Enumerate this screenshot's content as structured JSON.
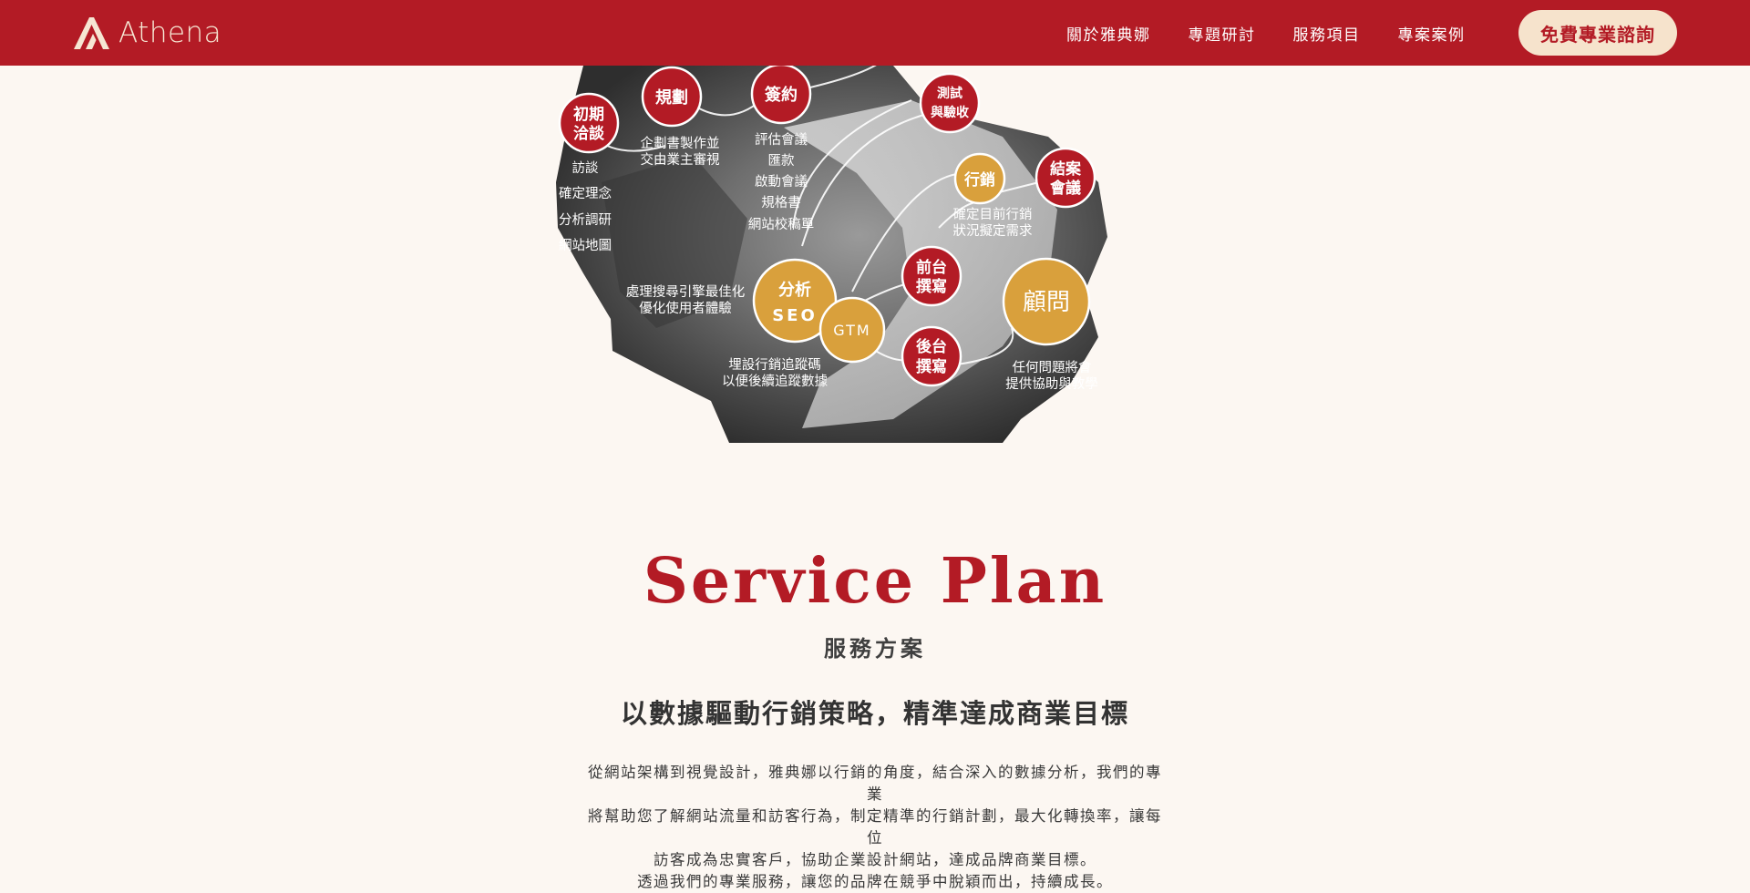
{
  "brand": {
    "name": "Athena",
    "icon": "athena-a-logo-icon"
  },
  "nav": {
    "items": [
      {
        "label": "關於雅典娜"
      },
      {
        "label": "專題研討"
      },
      {
        "label": "服務項目"
      },
      {
        "label": "專案案例"
      }
    ],
    "cta_label": "免費專業諮詢"
  },
  "colors": {
    "brand_red": "#b31b25",
    "gold": "#d9a03c",
    "cream": "#fcf7f2",
    "cta_bg": "#f6e3cc"
  },
  "process": {
    "nodes": [
      {
        "id": "initial",
        "lines": [
          "初期",
          "洽談"
        ],
        "color": "red"
      },
      {
        "id": "plan",
        "lines": [
          "規劃"
        ],
        "color": "red"
      },
      {
        "id": "contract",
        "lines": [
          "簽約"
        ],
        "color": "red"
      },
      {
        "id": "testing",
        "lines": [
          "測試",
          "與驗收"
        ],
        "color": "red"
      },
      {
        "id": "marketing",
        "lines": [
          "行銷"
        ],
        "color": "gold"
      },
      {
        "id": "closing",
        "lines": [
          "結案",
          "會議"
        ],
        "color": "red"
      },
      {
        "id": "frontend",
        "lines": [
          "前台",
          "撰寫"
        ],
        "color": "red"
      },
      {
        "id": "analytics-seo",
        "lines": [
          "分析",
          "SEO"
        ],
        "color": "gold"
      },
      {
        "id": "gtm",
        "lines": [
          "GTM"
        ],
        "color": "gold"
      },
      {
        "id": "backend",
        "lines": [
          "後台",
          "撰寫"
        ],
        "color": "red"
      },
      {
        "id": "consult",
        "lines": [
          "顧問"
        ],
        "color": "gold"
      }
    ],
    "notes": {
      "initial": [
        "訪談",
        "確定理念",
        "分析調研",
        "網站地圖"
      ],
      "plan": [
        "企劃書製作並",
        "交由業主審視"
      ],
      "contract": [
        "評估會議",
        "匯款",
        "啟動會議",
        "規格書",
        "網站校稿單"
      ],
      "seo": [
        "處理搜尋引擎最佳化",
        "優化使用者體驗"
      ],
      "gtm": [
        "埋設行銷追蹤碼",
        "以便後續追蹤數據"
      ],
      "marketing": [
        "確定目前行銷",
        "狀況擬定需求"
      ],
      "consult": [
        "任何問題將會",
        "提供協助與教學"
      ]
    }
  },
  "service_plan": {
    "title": "Service Plan",
    "subtitle": "服務方案",
    "headline": "以數據驅動行銷策略，精準達成商業目標",
    "body": [
      "從網站架構到視覺設計，雅典娜以行銷的角度，結合深入的數據分析，我們的專業",
      "將幫助您了解網站流量和訪客行為，制定精準的行銷計劃，最大化轉換率，讓每位",
      "訪客成為忠實客戶，協助企業設計網站，達成品牌商業目標。",
      "透過我們的專業服務，讓您的品牌在競爭中脫穎而出，持續成長。"
    ]
  }
}
